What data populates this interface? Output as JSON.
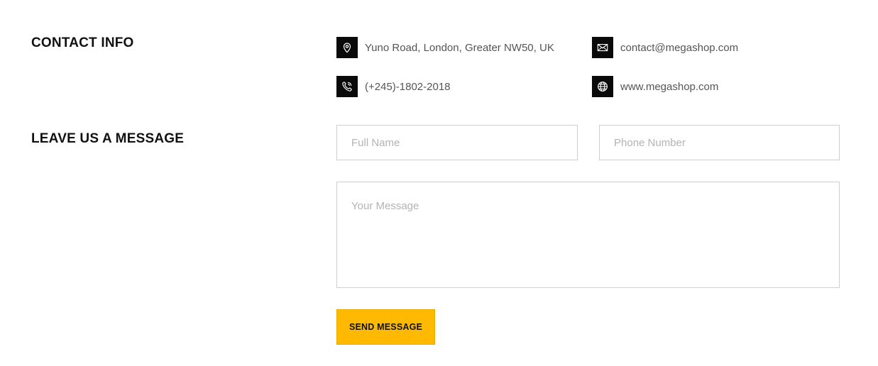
{
  "contact_info": {
    "title": "CONTACT INFO",
    "address": {
      "icon": "map-pin-icon",
      "text": "Yuno Road, London, Greater NW50, UK"
    },
    "email": {
      "icon": "envelope-icon",
      "text": "contact@megashop.com"
    },
    "phone": {
      "icon": "phone-icon",
      "text": "(+245)-1802-2018"
    },
    "website": {
      "icon": "globe-icon",
      "text": "www.megashop.com"
    }
  },
  "message_form": {
    "title": "LEAVE US A MESSAGE",
    "full_name": {
      "value": "",
      "placeholder": "Full Name"
    },
    "phone_number": {
      "value": "",
      "placeholder": "Phone Number"
    },
    "message": {
      "value": "",
      "placeholder": "Your Message"
    },
    "submit_label": "SEND MESSAGE"
  },
  "colors": {
    "accent": "#ffb900",
    "icon_background": "#0a0a0a",
    "heading": "#111111",
    "text": "#555555",
    "border": "#cfcfcf"
  }
}
